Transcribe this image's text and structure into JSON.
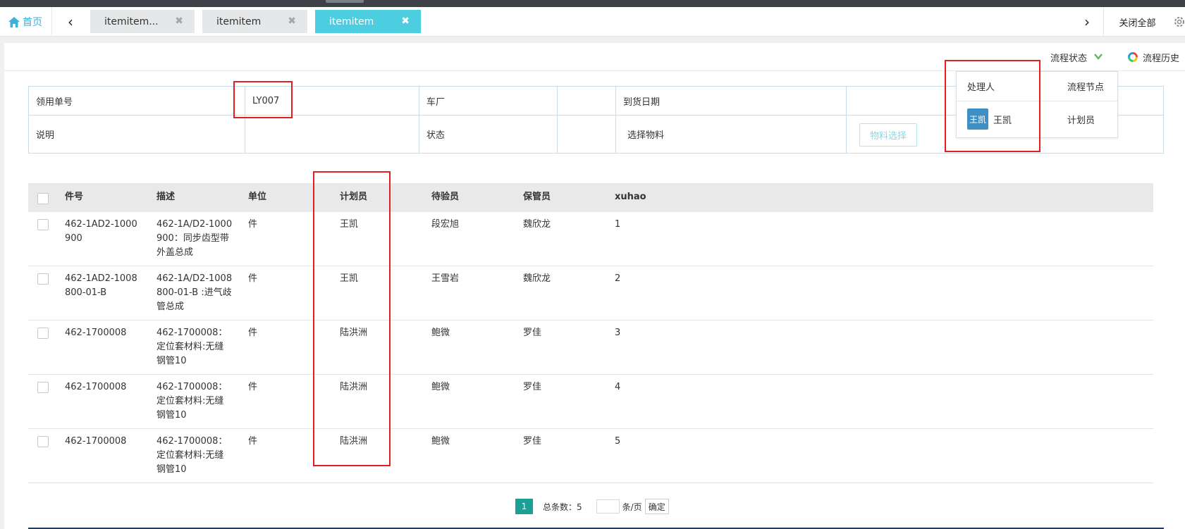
{
  "tabs": {
    "home_label": "首页",
    "items": [
      {
        "label": "itemitem...",
        "close": "✖"
      },
      {
        "label": "itemitem",
        "close": "✖"
      },
      {
        "label": "itemitem",
        "close": "✖"
      }
    ],
    "prev": "‹",
    "next": "›",
    "close_all": "关闭全部"
  },
  "toolbar": {
    "flow_status": "流程状态",
    "flow_history": "流程历史"
  },
  "form": {
    "order_no_label": "领用单号",
    "order_no_value": "LY007",
    "workshop_label": "车厂",
    "arrival_date_label": "到货日期",
    "desc_label": "说明",
    "status_label": "状态",
    "select_material_label": "选择物料",
    "material_button": "物料选择"
  },
  "popup": {
    "handler_header": "处理人",
    "node_header": "流程节点",
    "avatar_text": "王凯",
    "handler_name": "王凯",
    "node_value": "计划员"
  },
  "table": {
    "headers": [
      "件号",
      "描述",
      "单位",
      "计划员",
      "待验员",
      "保管员",
      "xuhao"
    ],
    "rows": [
      {
        "part": [
          "462-1AD2-1000",
          "900"
        ],
        "desc": [
          "462-1A/D2-1000",
          "900：同步齿型带",
          "外盖总成"
        ],
        "unit": "件",
        "planner": "王凯",
        "inspector": "段宏旭",
        "keeper": "魏欣龙",
        "xuhao": "1"
      },
      {
        "part": [
          "462-1AD2-1008",
          "800-01-B"
        ],
        "desc": [
          "462-1A/D2-1008",
          "800-01-B :进气歧",
          "管总成"
        ],
        "unit": "件",
        "planner": "王凯",
        "inspector": "王雪岩",
        "keeper": "魏欣龙",
        "xuhao": "2"
      },
      {
        "part": [
          "462-1700008"
        ],
        "desc": [
          "462-1700008：",
          "定位套材料:无缝",
          "钢管10"
        ],
        "unit": "件",
        "planner": "陆洪洲",
        "inspector": "鲍微",
        "keeper": "罗佳",
        "xuhao": "3"
      },
      {
        "part": [
          "462-1700008"
        ],
        "desc": [
          "462-1700008：",
          "定位套材料:无缝",
          "钢管10"
        ],
        "unit": "件",
        "planner": "陆洪洲",
        "inspector": "鲍微",
        "keeper": "罗佳",
        "xuhao": "4"
      },
      {
        "part": [
          "462-1700008"
        ],
        "desc": [
          "462-1700008：",
          "定位套材料:无缝",
          "钢管10"
        ],
        "unit": "件",
        "planner": "陆洪洲",
        "inspector": "鲍微",
        "keeper": "罗佳",
        "xuhao": "5"
      }
    ]
  },
  "pager": {
    "current_page": "1",
    "total_label": "总条数：5",
    "per_page_label": "条/页",
    "confirm": "确定"
  },
  "colors": {
    "accent_tab": "#4ccde0",
    "home_link": "#3fb1d6",
    "pager_active": "#1aa094",
    "annotation_red": "#e02020"
  }
}
